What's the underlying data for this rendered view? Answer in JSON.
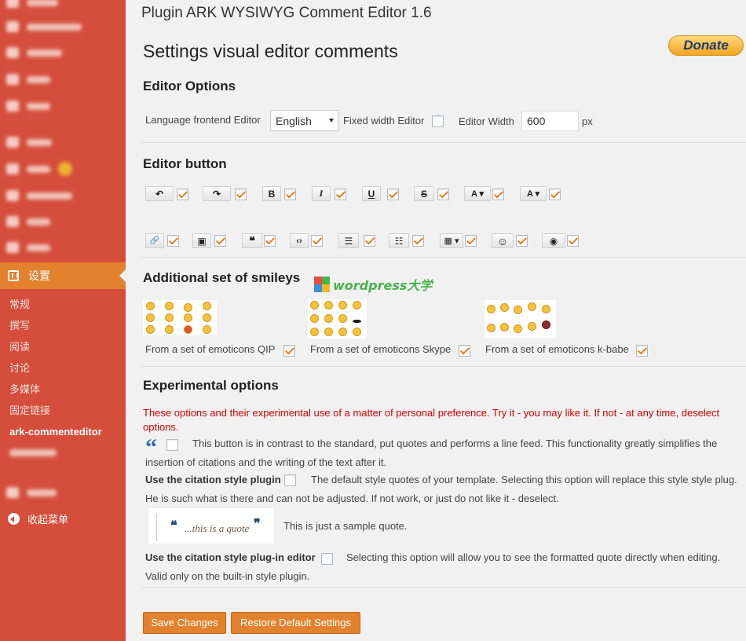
{
  "colors": {
    "sidebar": "#d54e3c",
    "accent": "#e3822e",
    "warning": "#d40000"
  },
  "sidebar": {
    "active_menu": "设置",
    "submenu": [
      "常规",
      "撰写",
      "阅读",
      "讨论",
      "多媒体",
      "固定链接",
      "ark-commenteditor"
    ],
    "collapse_label": "收起菜单"
  },
  "plugin_title": "Plugin ARK WYSIWYG Comment Editor 1.6",
  "page_title": "Settings visual editor comments",
  "donate_label": "Donate",
  "editor_options": {
    "heading": "Editor Options",
    "language_label": "Language frontend Editor",
    "language_value": "English",
    "fixed_width_label": "Fixed width Editor",
    "fixed_width_checked": false,
    "width_label": "Editor Width",
    "width_value": "600",
    "width_unit": "px"
  },
  "editor_button": {
    "heading": "Editor button",
    "row1": [
      {
        "icon": "undo-icon",
        "glyph": "↶",
        "checked": true
      },
      {
        "icon": "redo-icon",
        "glyph": "↷",
        "checked": true
      },
      {
        "icon": "bold-icon",
        "glyph": "B",
        "checked": true
      },
      {
        "icon": "italic-icon",
        "glyph": "I",
        "checked": true
      },
      {
        "icon": "underline-icon",
        "glyph": "U",
        "checked": true
      },
      {
        "icon": "strikethrough-icon",
        "glyph": "S",
        "checked": true
      },
      {
        "icon": "text-color-icon",
        "glyph": "A ▾",
        "checked": true
      },
      {
        "icon": "background-color-icon",
        "glyph": "A ▾",
        "checked": true
      }
    ],
    "row2": [
      {
        "icon": "link-icon",
        "glyph": "🔗",
        "checked": true
      },
      {
        "icon": "image-icon",
        "glyph": "▣",
        "checked": true
      },
      {
        "icon": "blockquote-icon",
        "glyph": "❝",
        "checked": true
      },
      {
        "icon": "code-icon",
        "glyph": "‹›",
        "checked": true
      },
      {
        "icon": "bullet-list-icon",
        "glyph": "☰",
        "checked": true
      },
      {
        "icon": "numbered-list-icon",
        "glyph": "☷",
        "checked": true
      },
      {
        "icon": "table-icon",
        "glyph": "▦ ▾",
        "checked": true
      },
      {
        "icon": "emoticon-icon",
        "glyph": "☺",
        "checked": true
      },
      {
        "icon": "preview-icon",
        "glyph": "◉",
        "checked": true
      }
    ]
  },
  "smileys": {
    "heading": "Additional set of smileys",
    "sets": [
      {
        "label": "From a set of emoticons QIP",
        "checked": true
      },
      {
        "label": "From a set of emoticons Skype",
        "checked": true
      },
      {
        "label": "From a set of emoticons k-babe",
        "checked": true
      }
    ]
  },
  "watermark": "wordpress大学",
  "experimental": {
    "heading": "Experimental options",
    "warning": "These options and their experimental use of a matter of personal preference. Try it - you may like it. If not - at any time, deselect options.",
    "quote_button_desc": "This button is in contrast to the standard, put quotes and performs a line feed. This functionality greatly simplifies the insertion of citations and the writing of the text after it.",
    "quote_button_checked": false,
    "citation_plugin_label": "Use the citation style plugin",
    "citation_plugin_checked": false,
    "citation_plugin_desc": "The default style quotes of your template. Selecting this option will replace this style style plug. He is such what is there and can not be adjusted. If not work, or just do not like it - deselect.",
    "sample_quote_text": "...this is a quote",
    "sample_quote_caption": "This is just a sample quote.",
    "citation_editor_label": "Use the citation style plug-in editor",
    "citation_editor_checked": false,
    "citation_editor_desc": "Selecting this option will allow you to see the formatted quote directly when editing. Valid only on the built-in style plugin."
  },
  "buttons": {
    "save": "Save Changes",
    "restore": "Restore Default Settings"
  }
}
